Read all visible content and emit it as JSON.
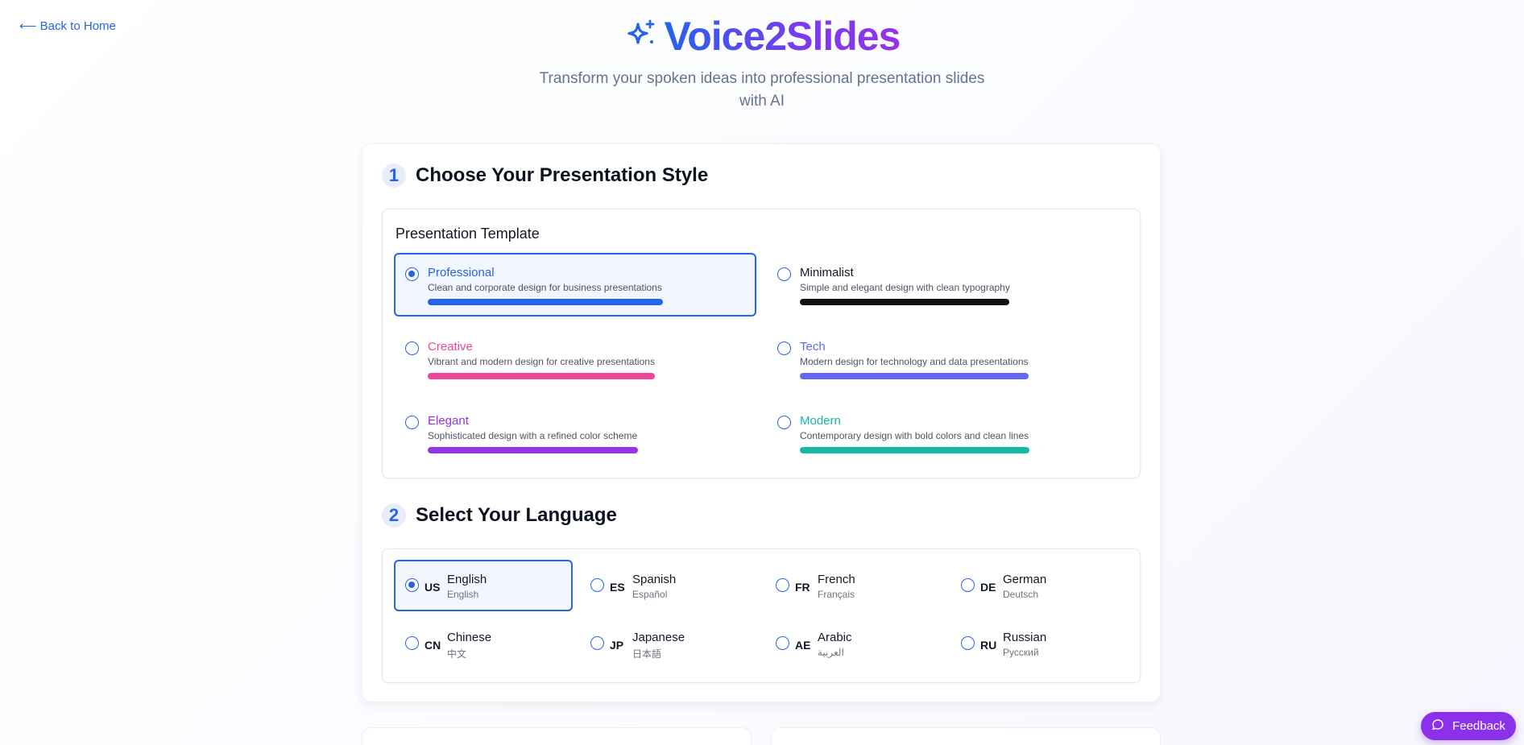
{
  "nav": {
    "back_label": "⟵ Back to Home"
  },
  "header": {
    "title": "Voice2Slides",
    "subtitle": "Transform your spoken ideas into professional presentation slides with AI",
    "logo_icon": "sparkles-icon",
    "gradient": [
      "#2563eb",
      "#9333ea"
    ]
  },
  "step1": {
    "number": "1",
    "title": "Choose Your Presentation Style",
    "panel_label": "Presentation Template",
    "templates": [
      {
        "name": "Professional",
        "desc": "Clean and corporate design for business presentations",
        "color": "#2563eb",
        "name_color": "#2563eb",
        "selected": true
      },
      {
        "name": "Minimalist",
        "desc": "Simple and elegant design with clean typography",
        "color": "#111111",
        "name_color": "#111827",
        "selected": false
      },
      {
        "name": "Creative",
        "desc": "Vibrant and modern design for creative presentations",
        "color": "#ec4899",
        "name_color": "#ec4899",
        "selected": false
      },
      {
        "name": "Tech",
        "desc": "Modern design for technology and data presentations",
        "color": "#6366f1",
        "name_color": "#6366f1",
        "selected": false
      },
      {
        "name": "Elegant",
        "desc": "Sophisticated design with a refined color scheme",
        "color": "#9333ea",
        "name_color": "#9333ea",
        "selected": false
      },
      {
        "name": "Modern",
        "desc": "Contemporary design with bold colors and clean lines",
        "color": "#14b8a6",
        "name_color": "#14b8a6",
        "selected": false
      }
    ]
  },
  "step2": {
    "number": "2",
    "title": "Select Your Language",
    "languages": [
      {
        "code": "US",
        "name": "English",
        "native": "English",
        "selected": true
      },
      {
        "code": "ES",
        "name": "Spanish",
        "native": "Español",
        "selected": false
      },
      {
        "code": "FR",
        "name": "French",
        "native": "Français",
        "selected": false
      },
      {
        "code": "DE",
        "name": "German",
        "native": "Deutsch",
        "selected": false
      },
      {
        "code": "CN",
        "name": "Chinese",
        "native": "中文",
        "selected": false
      },
      {
        "code": "JP",
        "name": "Japanese",
        "native": "日本語",
        "selected": false
      },
      {
        "code": "AE",
        "name": "Arabic",
        "native": "العربية",
        "selected": false
      },
      {
        "code": "RU",
        "name": "Russian",
        "native": "Русский",
        "selected": false
      }
    ]
  },
  "feedback": {
    "label": "Feedback",
    "icon": "chat-bubble-icon",
    "color": "#8b31ea"
  }
}
